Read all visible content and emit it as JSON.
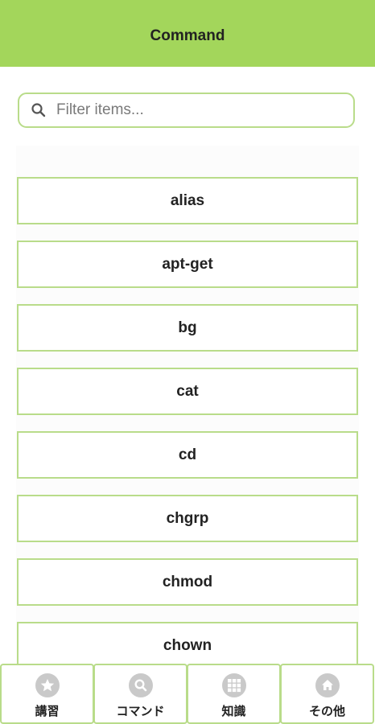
{
  "header": {
    "title": "Command"
  },
  "search": {
    "placeholder": "Filter items...",
    "value": ""
  },
  "commands": [
    "alias",
    "apt-get",
    "bg",
    "cat",
    "cd",
    "chgrp",
    "chmod",
    "chown"
  ],
  "tabs": [
    {
      "label": "講習",
      "icon": "star-icon"
    },
    {
      "label": "コマンド",
      "icon": "search-icon"
    },
    {
      "label": "知識",
      "icon": "grid-icon"
    },
    {
      "label": "その他",
      "icon": "home-icon"
    }
  ],
  "colors": {
    "accent": "#a3d65b",
    "border": "#b9dc8a",
    "icon": "#c9c9c9"
  }
}
